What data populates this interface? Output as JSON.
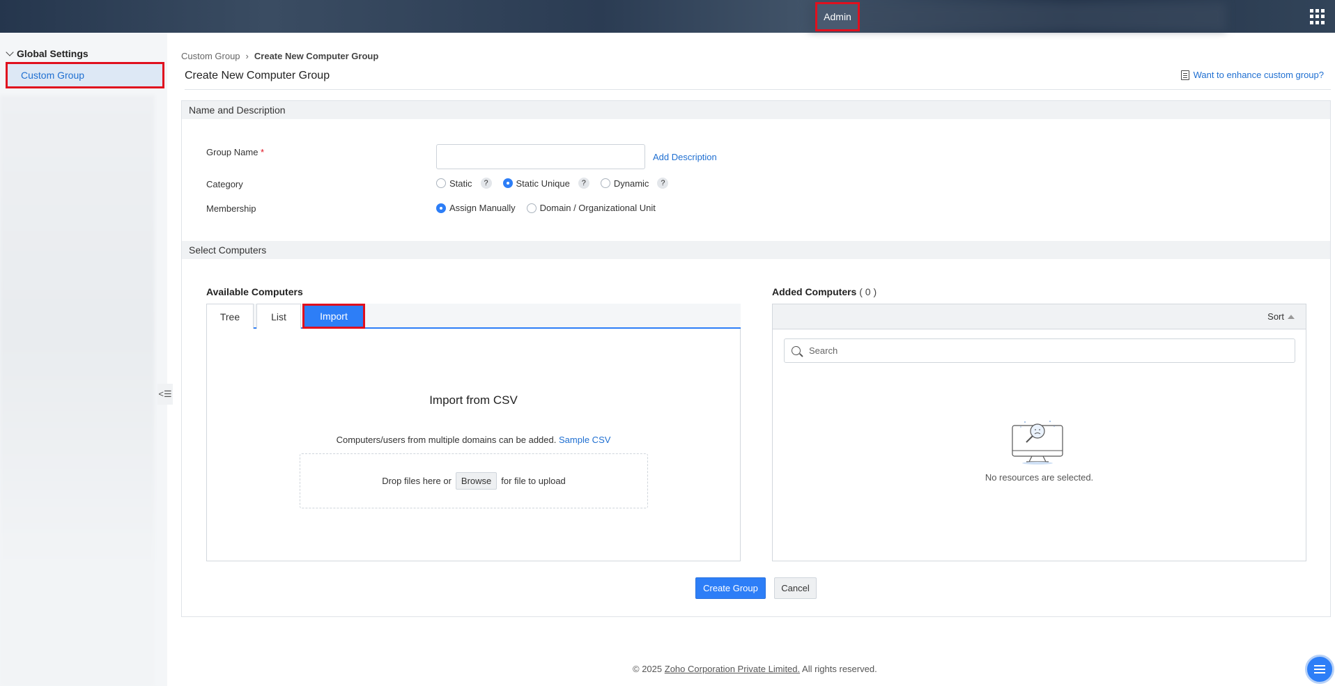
{
  "topbar": {
    "admin_label": "Admin"
  },
  "sidebar": {
    "heading": "Global Settings",
    "items": [
      {
        "label": "Custom Group",
        "active": true
      }
    ]
  },
  "breadcrumb": {
    "parent": "Custom Group",
    "current": "Create New Computer Group"
  },
  "page": {
    "title": "Create New Computer Group",
    "enhance_link": "Want to enhance custom group?"
  },
  "name_section": {
    "heading": "Name and Description",
    "group_name_label": "Group Name",
    "required_mark": "*",
    "group_name_value": "",
    "add_description": "Add Description",
    "category_label": "Category",
    "category_options": [
      {
        "label": "Static",
        "selected": false
      },
      {
        "label": "Static Unique",
        "selected": true
      },
      {
        "label": "Dynamic",
        "selected": false
      }
    ],
    "help_glyph": "?",
    "membership_label": "Membership",
    "membership_options": [
      {
        "label": "Assign Manually",
        "selected": true
      },
      {
        "label": "Domain / Organizational Unit",
        "selected": false
      }
    ]
  },
  "select_section": {
    "heading": "Select Computers",
    "available_title": "Available Computers",
    "tabs": [
      {
        "label": "Tree",
        "active": false
      },
      {
        "label": "List",
        "active": false
      },
      {
        "label": "Import",
        "active": true
      }
    ],
    "import": {
      "title": "Import from CSV",
      "note": "Computers/users from multiple domains can be added.",
      "sample_link": "Sample CSV",
      "drop_text_before": "Drop files here or",
      "browse_label": "Browse",
      "drop_text_after": "for file to upload"
    },
    "added_title": "Added Computers",
    "added_count": "( 0 )",
    "sort_label": "Sort",
    "search_placeholder": "Search",
    "empty_text": "No resources are selected."
  },
  "actions": {
    "create_label": "Create Group",
    "cancel_label": "Cancel"
  },
  "footer": {
    "prefix": "© 2025",
    "company": "Zoho Corporation Private Limited.",
    "suffix": "All rights reserved."
  },
  "colors": {
    "accent": "#2d7ef7",
    "highlight_border": "#e0101e",
    "link": "#1f6fd1"
  }
}
